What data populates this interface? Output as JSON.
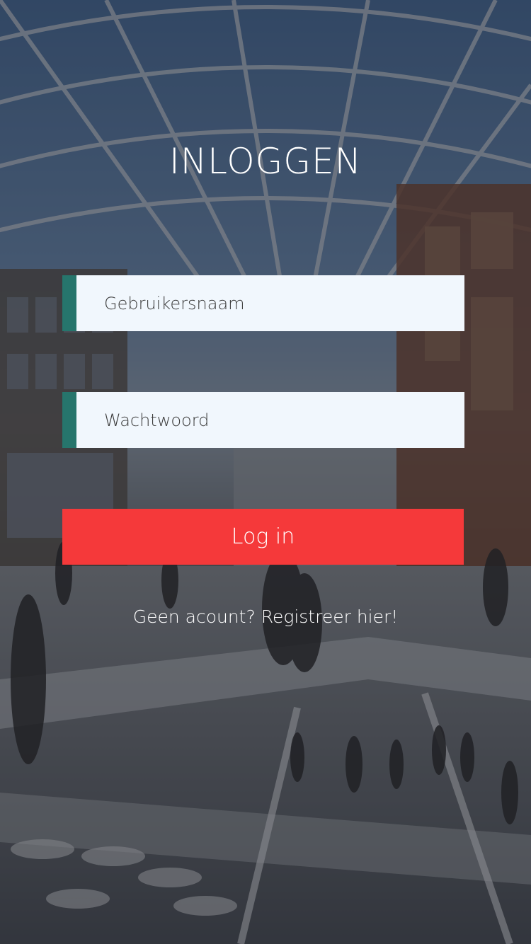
{
  "screen": {
    "title": "INLOGGEN"
  },
  "form": {
    "username": {
      "placeholder": "Gebruikersnaam",
      "value": ""
    },
    "password": {
      "placeholder": "Wachtwoord",
      "value": ""
    },
    "login_label": "Log in",
    "register_text": "Geen acount? Registreer hier!"
  },
  "colors": {
    "accent": "#26756c",
    "login_button": "#f5393a",
    "field_background": "#f1f7fd",
    "title_text": "#ffffff"
  },
  "background": {
    "description_icon": "shopping-mall-atrium-photo"
  }
}
